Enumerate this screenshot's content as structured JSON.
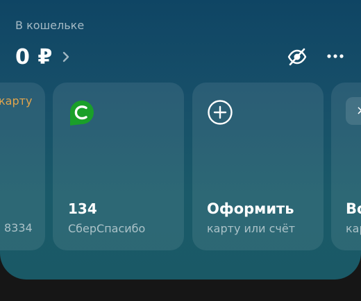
{
  "wallet": {
    "label": "В кошельке",
    "balance": "0 ₽"
  },
  "cards": {
    "first": {
      "link": "карту",
      "number": "8334"
    },
    "spasibo": {
      "value": "134",
      "label": "СберСпасибо"
    },
    "order": {
      "title": "Оформить",
      "subtitle": "карту или счёт"
    },
    "last": {
      "button": "×",
      "title": "Во",
      "subtitle": "кар"
    }
  },
  "colors": {
    "accent_orange": "#e2a54c",
    "sber_green": "#1a9f29"
  }
}
